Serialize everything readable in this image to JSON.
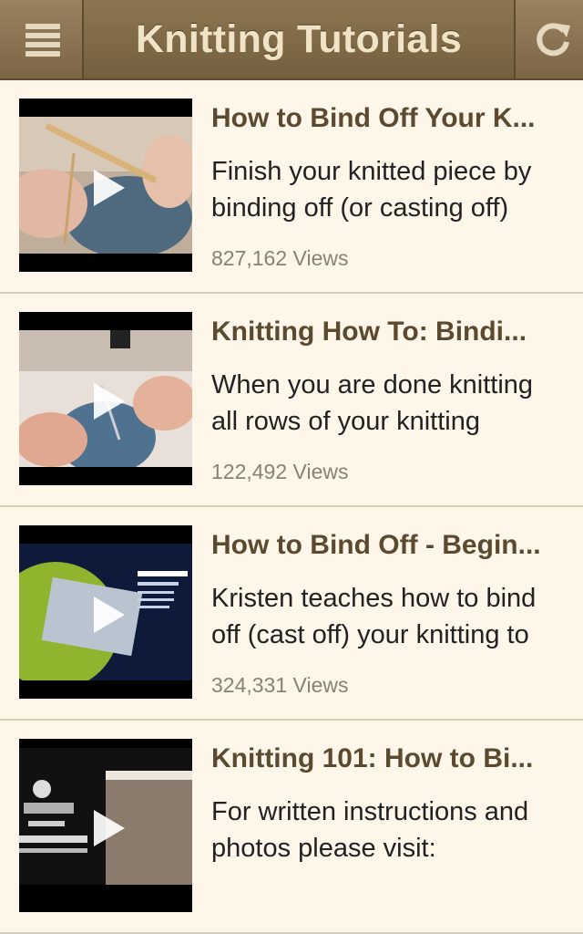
{
  "header": {
    "title": "Knitting Tutorials",
    "menu_icon": "menu-icon",
    "refresh_icon": "refresh-icon"
  },
  "videos": [
    {
      "title": "How to Bind Off Your K...",
      "description_line1": "Finish your knitted piece by",
      "description_line2": "binding off (or casting off)",
      "views": "827,162 Views"
    },
    {
      "title": "Knitting How To: Bindi...",
      "description_line1": "When you are done knitting",
      "description_line2": "all rows of your knitting",
      "views": "122,492 Views"
    },
    {
      "title": "How to Bind Off - Begin...",
      "description_line1": "Kristen teaches how to bind",
      "description_line2": "off (cast off) your knitting to",
      "views": "324,331 Views"
    },
    {
      "title": "Knitting 101: How to Bi...",
      "description_line1": "For written instructions and",
      "description_line2": "photos please visit:",
      "views": ""
    }
  ],
  "colors": {
    "header_bg": "#7f6a48",
    "title_text": "#efe4c6",
    "item_title": "#5c4a30",
    "background": "#fdf6e9",
    "views_text": "#8a8174"
  }
}
